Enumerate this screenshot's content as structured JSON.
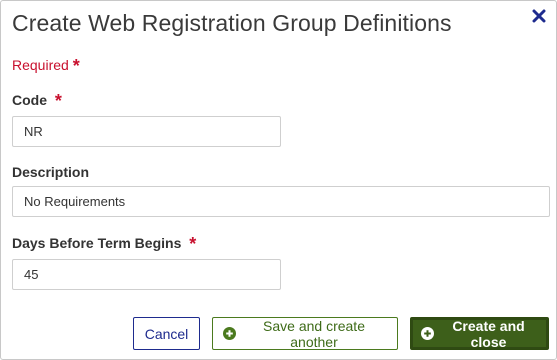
{
  "dialog": {
    "title": "Create Web Registration Group Definitions",
    "required_note": "Required",
    "required_marker": "*"
  },
  "fields": {
    "code": {
      "label": "Code",
      "value": "NR",
      "required": true
    },
    "description": {
      "label": "Description",
      "value": "No Requirements",
      "required": false
    },
    "days_before": {
      "label": "Days Before Term Begins",
      "value": "45",
      "required": true
    }
  },
  "buttons": {
    "cancel": "Cancel",
    "save_another": "Save and create another",
    "create_close": "Create and close"
  },
  "colors": {
    "required": "#c8102e",
    "primary_green": "#3d5f1a",
    "cancel_blue": "#1e2b8e",
    "close_icon": "#1e2b8e"
  },
  "icons": {
    "close": "close-icon",
    "save_another": "plus-circle-icon",
    "create_close": "plus-circle-icon"
  }
}
